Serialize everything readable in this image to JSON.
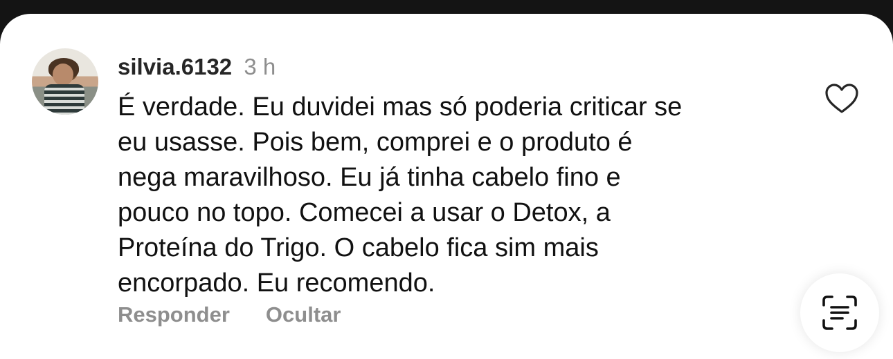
{
  "comment": {
    "username": "silvia.6132",
    "time": "3 h",
    "lines": [
      "É verdade. Eu duvidei mas só poderia criticar se",
      "eu usasse. Pois bem, comprei e o produto é",
      "nega maravilhoso. Eu já tinha cabelo fino e",
      "pouco no topo. Comecei a usar o Detox, a",
      "Proteína do Trigo. O cabelo fica sim mais",
      "encorpado. Eu recomendo."
    ],
    "reply_label": "Responder",
    "hide_label": "Ocultar"
  },
  "icons": {
    "like": "heart-icon",
    "scan": "scan-text-icon"
  }
}
